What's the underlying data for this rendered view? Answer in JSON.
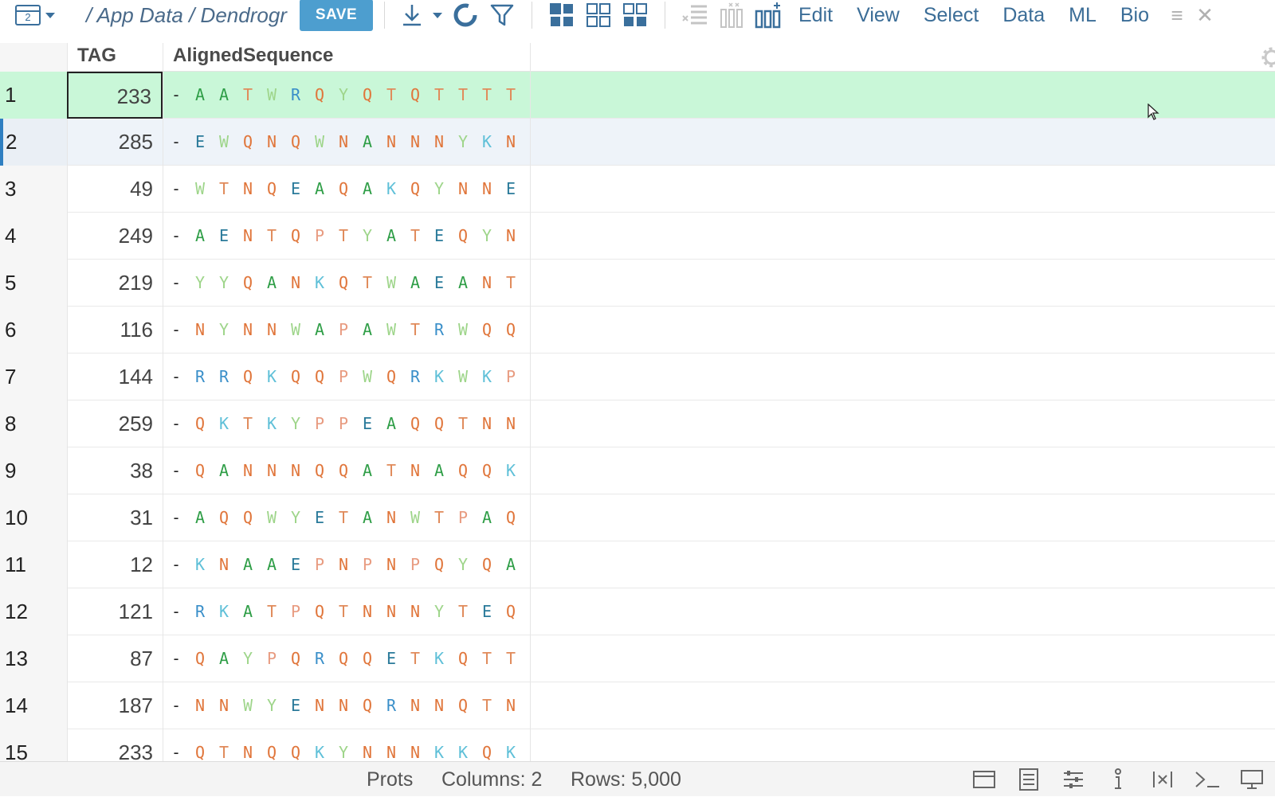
{
  "toolbar": {
    "view_count": "2",
    "path": "/ App Data / Dendrogr",
    "save_label": "SAVE",
    "menus": [
      "Edit",
      "View",
      "Select",
      "Data",
      "ML",
      "Bio"
    ]
  },
  "grid": {
    "columns": [
      {
        "name": "TAG"
      },
      {
        "name": "AlignedSequence"
      }
    ],
    "rows": [
      {
        "num": "1",
        "tag": "233",
        "seq": [
          "-",
          "A",
          "A",
          "T",
          "W",
          "R",
          "Q",
          "Y",
          "Q",
          "T",
          "Q",
          "T",
          "T",
          "T",
          "T"
        ]
      },
      {
        "num": "2",
        "tag": "285",
        "seq": [
          "-",
          "E",
          "W",
          "Q",
          "N",
          "Q",
          "W",
          "N",
          "A",
          "N",
          "N",
          "N",
          "Y",
          "K",
          "N"
        ]
      },
      {
        "num": "3",
        "tag": "49",
        "seq": [
          "-",
          "W",
          "T",
          "N",
          "Q",
          "E",
          "A",
          "Q",
          "A",
          "K",
          "Q",
          "Y",
          "N",
          "N",
          "E"
        ]
      },
      {
        "num": "4",
        "tag": "249",
        "seq": [
          "-",
          "A",
          "E",
          "N",
          "T",
          "Q",
          "P",
          "T",
          "Y",
          "A",
          "T",
          "E",
          "Q",
          "Y",
          "N"
        ]
      },
      {
        "num": "5",
        "tag": "219",
        "seq": [
          "-",
          "Y",
          "Y",
          "Q",
          "A",
          "N",
          "K",
          "Q",
          "T",
          "W",
          "A",
          "E",
          "A",
          "N",
          "T"
        ]
      },
      {
        "num": "6",
        "tag": "116",
        "seq": [
          "-",
          "N",
          "Y",
          "N",
          "N",
          "W",
          "A",
          "P",
          "A",
          "W",
          "T",
          "R",
          "W",
          "Q",
          "Q"
        ]
      },
      {
        "num": "7",
        "tag": "144",
        "seq": [
          "-",
          "R",
          "R",
          "Q",
          "K",
          "Q",
          "Q",
          "P",
          "W",
          "Q",
          "R",
          "K",
          "W",
          "K",
          "P"
        ]
      },
      {
        "num": "8",
        "tag": "259",
        "seq": [
          "-",
          "Q",
          "K",
          "T",
          "K",
          "Y",
          "P",
          "P",
          "E",
          "A",
          "Q",
          "Q",
          "T",
          "N",
          "N"
        ]
      },
      {
        "num": "9",
        "tag": "38",
        "seq": [
          "-",
          "Q",
          "A",
          "N",
          "N",
          "N",
          "Q",
          "Q",
          "A",
          "T",
          "N",
          "A",
          "Q",
          "Q",
          "K"
        ]
      },
      {
        "num": "10",
        "tag": "31",
        "seq": [
          "-",
          "A",
          "Q",
          "Q",
          "W",
          "Y",
          "E",
          "T",
          "A",
          "N",
          "W",
          "T",
          "P",
          "A",
          "Q"
        ]
      },
      {
        "num": "11",
        "tag": "12",
        "seq": [
          "-",
          "K",
          "N",
          "A",
          "A",
          "E",
          "P",
          "N",
          "P",
          "N",
          "P",
          "Q",
          "Y",
          "Q",
          "A"
        ]
      },
      {
        "num": "12",
        "tag": "121",
        "seq": [
          "-",
          "R",
          "K",
          "A",
          "T",
          "P",
          "Q",
          "T",
          "N",
          "N",
          "N",
          "Y",
          "T",
          "E",
          "Q"
        ]
      },
      {
        "num": "13",
        "tag": "87",
        "seq": [
          "-",
          "Q",
          "A",
          "Y",
          "P",
          "Q",
          "R",
          "Q",
          "Q",
          "E",
          "T",
          "K",
          "Q",
          "T",
          "T"
        ]
      },
      {
        "num": "14",
        "tag": "187",
        "seq": [
          "-",
          "N",
          "N",
          "W",
          "Y",
          "E",
          "N",
          "N",
          "Q",
          "R",
          "N",
          "N",
          "Q",
          "T",
          "N"
        ]
      },
      {
        "num": "15",
        "tag": "233",
        "seq": [
          "-",
          "Q",
          "T",
          "N",
          "Q",
          "Q",
          "K",
          "Y",
          "N",
          "N",
          "N",
          "K",
          "K",
          "Q",
          "K"
        ]
      }
    ]
  },
  "status": {
    "table_name": "Prots",
    "columns_text": "Columns: 2",
    "rows_text": "Rows: 5,000"
  }
}
